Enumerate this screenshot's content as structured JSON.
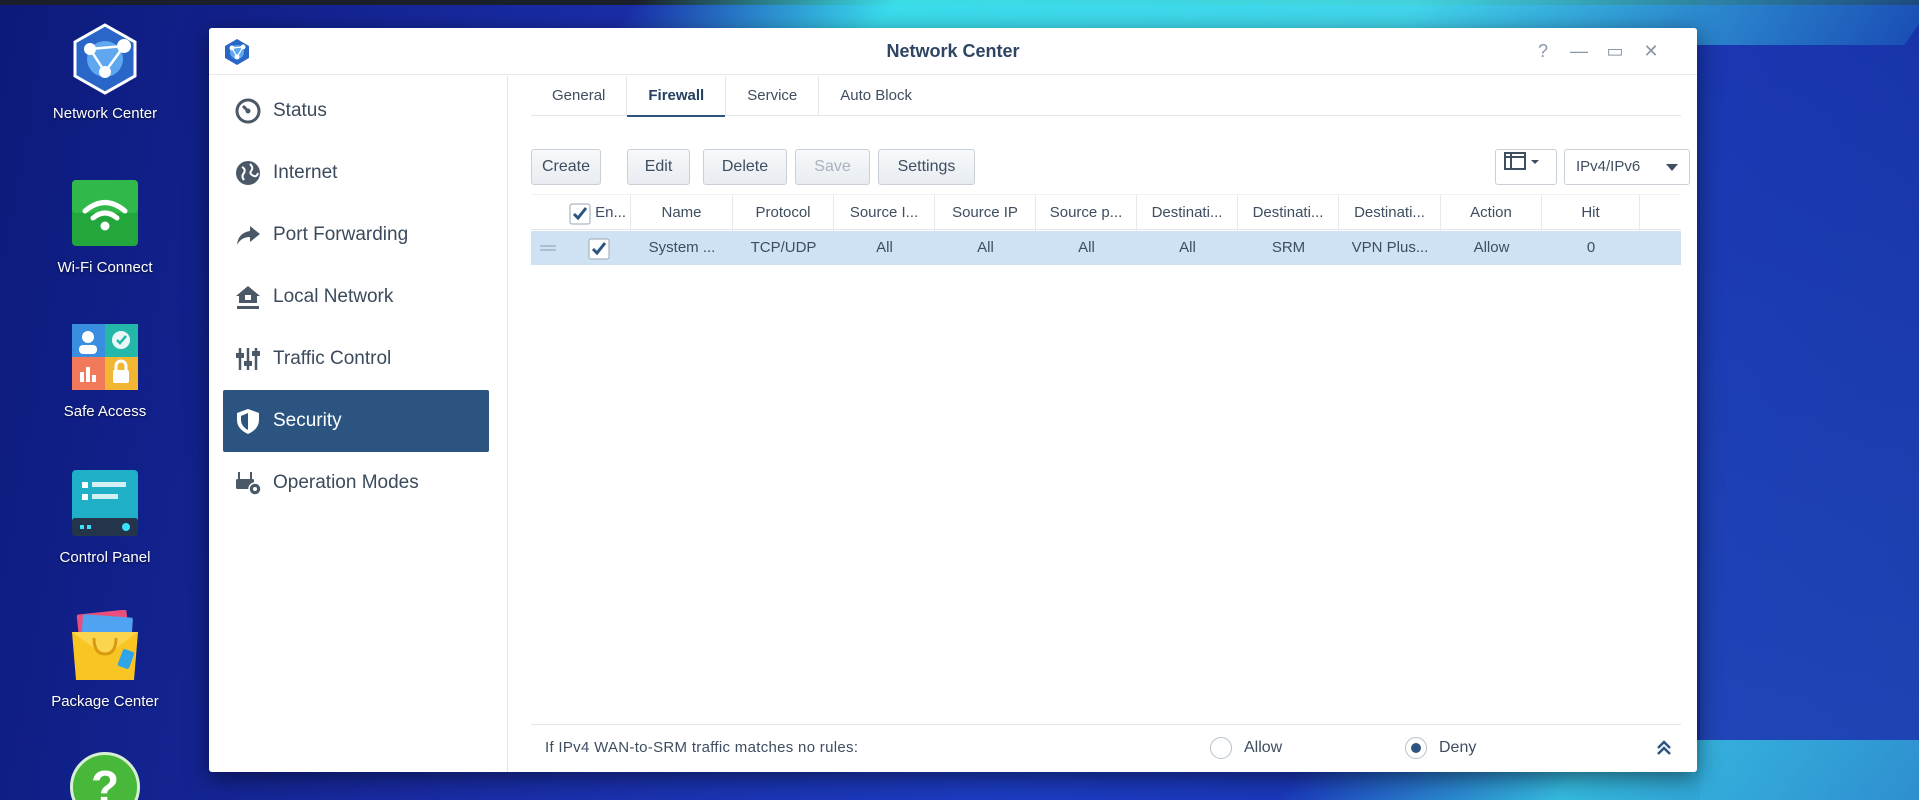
{
  "desktop": {
    "icons": [
      {
        "label": "Network Center"
      },
      {
        "label": "Wi-Fi Connect"
      },
      {
        "label": "Safe Access"
      },
      {
        "label": "Control Panel"
      },
      {
        "label": "Package Center"
      }
    ]
  },
  "window": {
    "title": "Network Center",
    "controls": {
      "help": "?",
      "minimize": "—",
      "maximize": "▭",
      "close": "✕"
    }
  },
  "sidebar": {
    "items": [
      {
        "label": "Status",
        "icon": "gauge-icon"
      },
      {
        "label": "Internet",
        "icon": "globe-icon"
      },
      {
        "label": "Port Forwarding",
        "icon": "forward-arrow-icon"
      },
      {
        "label": "Local Network",
        "icon": "home-network-icon"
      },
      {
        "label": "Traffic Control",
        "icon": "sliders-icon"
      },
      {
        "label": "Security",
        "icon": "shield-icon",
        "active": true
      },
      {
        "label": "Operation Modes",
        "icon": "router-gear-icon"
      }
    ]
  },
  "tabs": [
    {
      "label": "General"
    },
    {
      "label": "Firewall",
      "active": true
    },
    {
      "label": "Service"
    },
    {
      "label": "Auto Block"
    }
  ],
  "toolbar": {
    "create": "Create",
    "edit": "Edit",
    "delete": "Delete",
    "save": "Save",
    "settings": "Settings",
    "ip_select": "IPv4/IPv6"
  },
  "grid": {
    "columns": [
      "En...",
      "Name",
      "Protocol",
      "Source I...",
      "Source IP",
      "Source p...",
      "Destinati...",
      "Destinati...",
      "Destinati...",
      "Action",
      "Hit"
    ],
    "rows": [
      {
        "enabled": true,
        "cells": [
          "System ...",
          "TCP/UDP",
          "All",
          "All",
          "All",
          "All",
          "SRM",
          "VPN Plus...",
          "Allow",
          "0"
        ]
      }
    ]
  },
  "footer": {
    "message": "If IPv4 WAN-to-SRM traffic matches no rules:",
    "allow": "Allow",
    "deny": "Deny",
    "selected": "Deny"
  },
  "colors": {
    "accent": "#2c5480",
    "row_selected": "#cfe2f3",
    "title": "#2e4563"
  }
}
